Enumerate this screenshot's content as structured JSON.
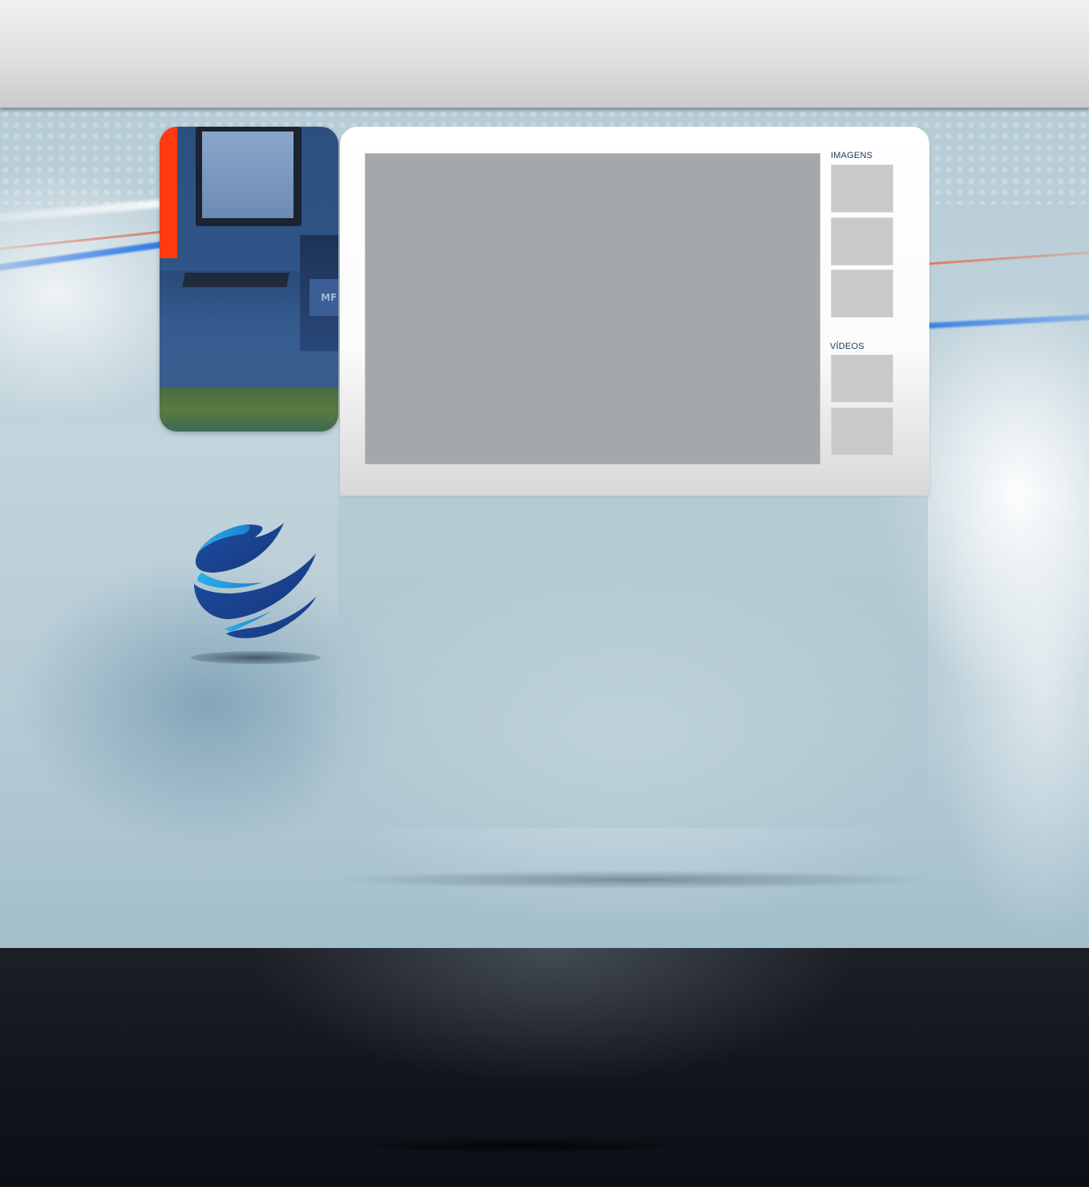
{
  "header": {},
  "photo_panel": {
    "sign_text": "MF",
    "accent_color": "#ff3b12"
  },
  "logo": {
    "icon": "globe-icon",
    "primary_color": "#1b3f8f",
    "secondary_color": "#2aa3e0"
  },
  "gallery": {
    "images_label": "IMAGENS",
    "videos_label": "VÍDEOS",
    "image_thumbnails": 3,
    "video_thumbnails": 2,
    "viewer_color": "#a3a8ac",
    "thumbnail_color": "#c9c9c9"
  },
  "colors": {
    "background": "#b6ccd6",
    "footer": "#10141b",
    "label": "#1e3a66"
  }
}
